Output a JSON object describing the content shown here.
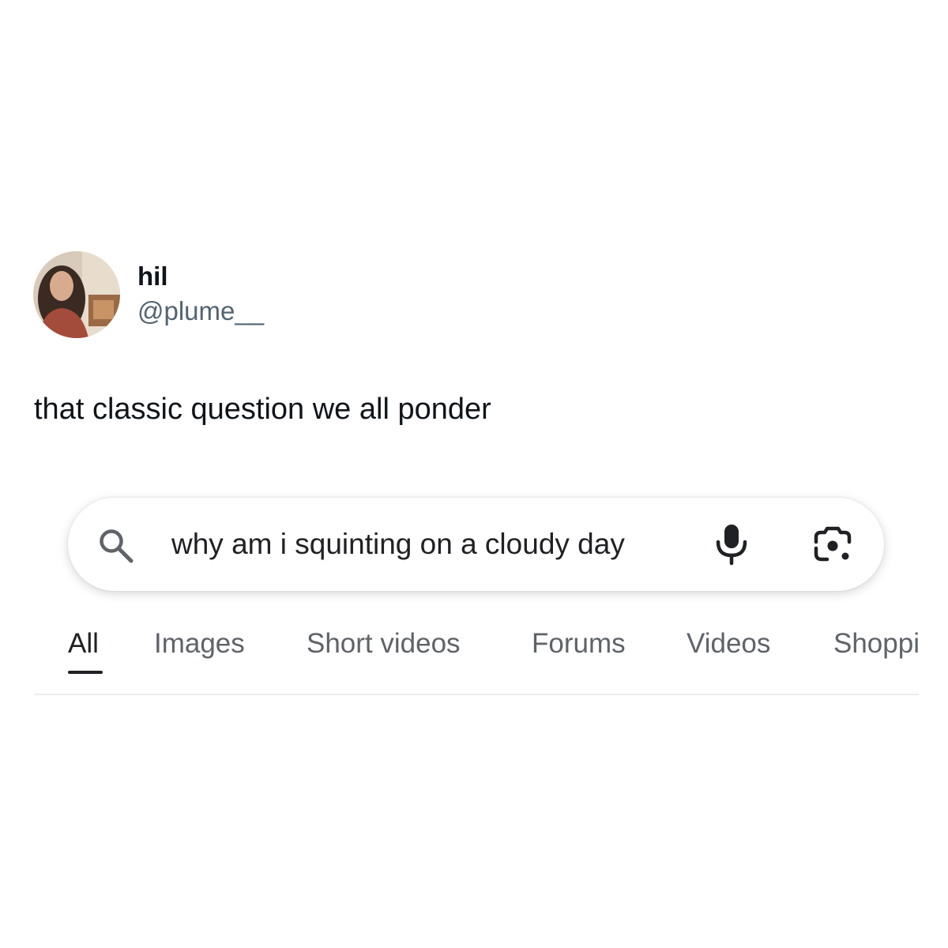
{
  "post": {
    "author": {
      "display_name": "hil",
      "handle": "@plume__"
    },
    "text": "that classic question we all ponder"
  },
  "search": {
    "query": "why am i squinting on a cloudy day",
    "icons": {
      "search": "search-icon",
      "voice": "microphone-icon",
      "image_search": "lens-camera-icon"
    }
  },
  "tabs": [
    {
      "label": "All",
      "active": true
    },
    {
      "label": "Images",
      "active": false
    },
    {
      "label": "Short videos",
      "active": false
    },
    {
      "label": "Forums",
      "active": false
    },
    {
      "label": "Videos",
      "active": false
    },
    {
      "label": "Shopping",
      "active": false
    }
  ],
  "colors": {
    "text_primary": "#0f1419",
    "text_secondary": "#536471",
    "tab_inactive": "#5f6368",
    "tab_active": "#202124"
  }
}
